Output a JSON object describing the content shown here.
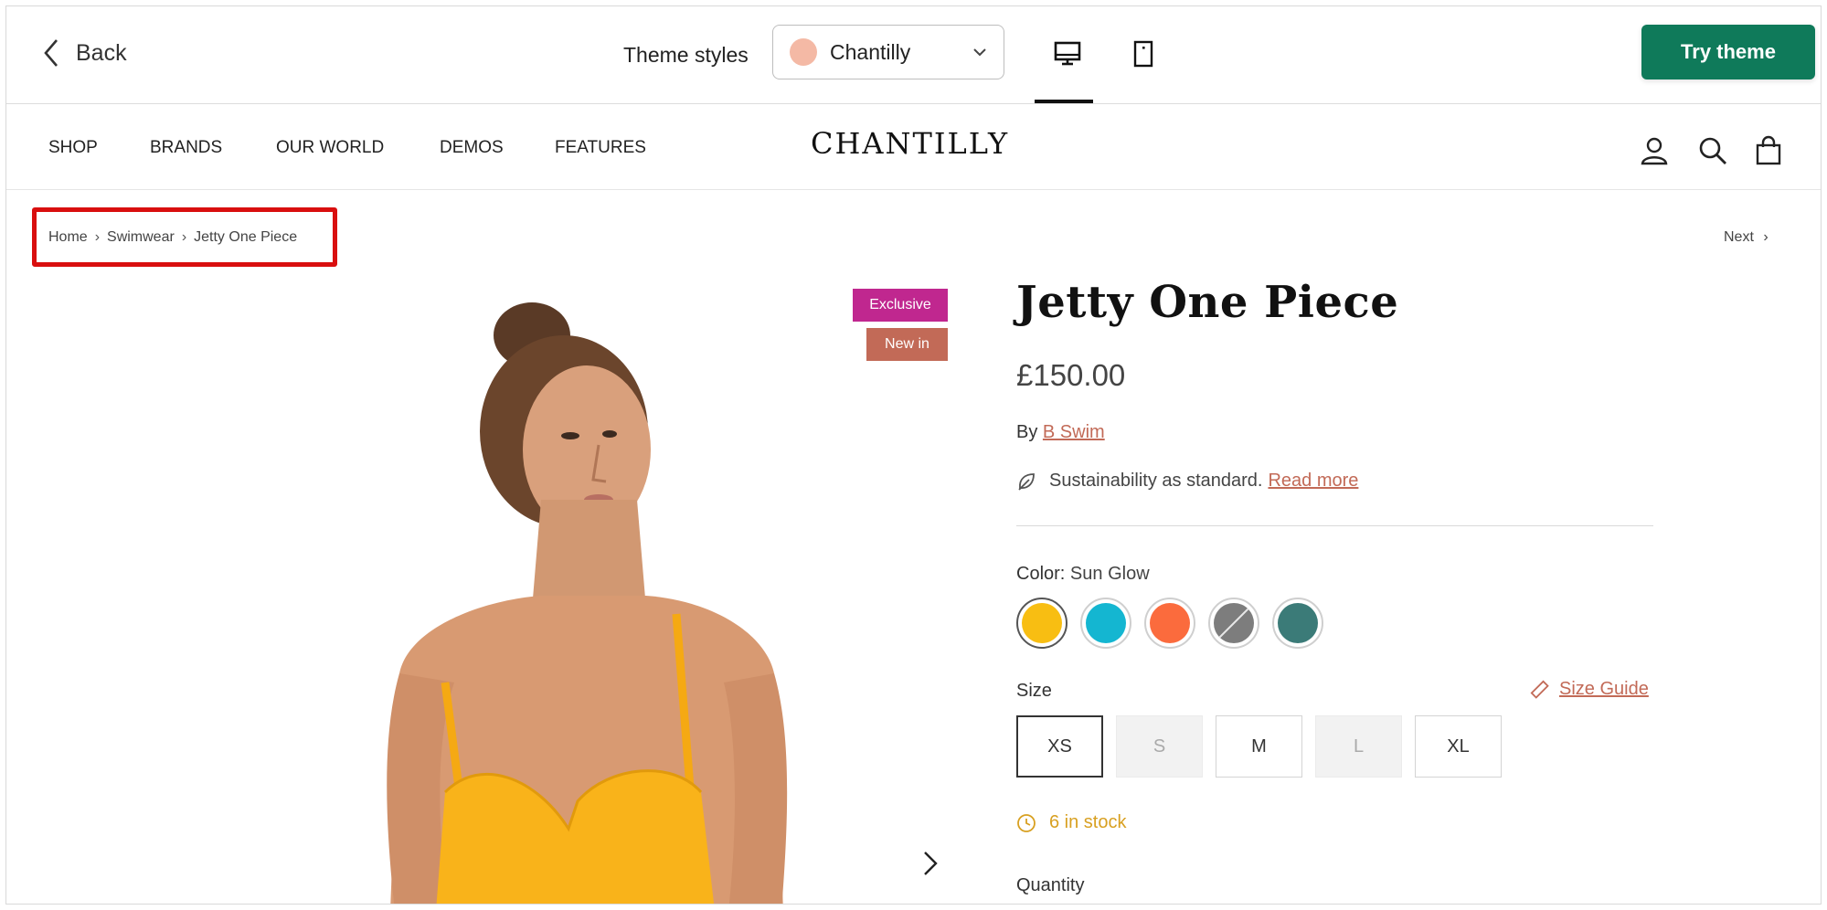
{
  "topbar": {
    "back_label": "Back",
    "theme_styles_label": "Theme styles",
    "selected_style": "Chantilly",
    "selected_style_color": "#f4b9a5",
    "try_button": "Try theme",
    "try_button_color": "#0f7a5a",
    "views": [
      "desktop",
      "mobile"
    ],
    "active_view": "desktop"
  },
  "store": {
    "logo": "CHANTILLY",
    "nav": [
      "SHOP",
      "BRANDS",
      "OUR WORLD",
      "DEMOS",
      "FEATURES"
    ],
    "icons": [
      "account-icon",
      "search-icon",
      "cart-icon"
    ]
  },
  "breadcrumb": {
    "items": [
      "Home",
      "Swimwear",
      "Jetty One Piece"
    ],
    "next_label": "Next"
  },
  "product": {
    "badges": [
      "Exclusive",
      "New in"
    ],
    "badge_colors": [
      "#c0278f",
      "#c26a57"
    ],
    "title": "Jetty One Piece",
    "price": "£150.00",
    "by_prefix": "By",
    "brand": "B Swim",
    "sustainability_text": "Sustainability as standard.",
    "sustainability_link": "Read more",
    "color_label": "Color:",
    "color_value": "Sun Glow",
    "swatches": [
      {
        "color": "#f8be12",
        "selected": true,
        "available": true
      },
      {
        "color": "#14b6d1",
        "selected": false,
        "available": true
      },
      {
        "color": "#fb6b3d",
        "selected": false,
        "available": true
      },
      {
        "color": "#7d7d7d",
        "selected": false,
        "available": false
      },
      {
        "color": "#3b7b78",
        "selected": false,
        "available": true
      }
    ],
    "size_label": "Size",
    "size_guide": "Size Guide",
    "sizes": [
      {
        "label": "XS",
        "selected": true,
        "available": true
      },
      {
        "label": "S",
        "selected": false,
        "available": false
      },
      {
        "label": "M",
        "selected": false,
        "available": true
      },
      {
        "label": "L",
        "selected": false,
        "available": false
      },
      {
        "label": "XL",
        "selected": false,
        "available": true
      }
    ],
    "stock": "6 in stock",
    "quantity_label": "Quantity"
  }
}
